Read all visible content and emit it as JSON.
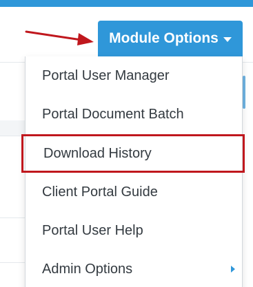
{
  "header": {
    "module_button_label": "Module Options"
  },
  "colors": {
    "accent": "#2f97d9",
    "highlight_border": "#c0171d",
    "annotation_arrow": "#c0171d",
    "menu_text": "#333a40"
  },
  "icons": {
    "module_button_caret": "caret-down-icon",
    "submenu_caret": "caret-right-icon",
    "annotation": "red-arrow-icon"
  },
  "menu": {
    "items": [
      {
        "label": "Portal User Manager"
      },
      {
        "label": "Portal Document Batch"
      },
      {
        "label": "Download History",
        "highlighted": true
      },
      {
        "label": "Client Portal Guide"
      },
      {
        "label": "Portal User Help"
      },
      {
        "label": "Admin Options",
        "has_submenu": true
      }
    ]
  }
}
